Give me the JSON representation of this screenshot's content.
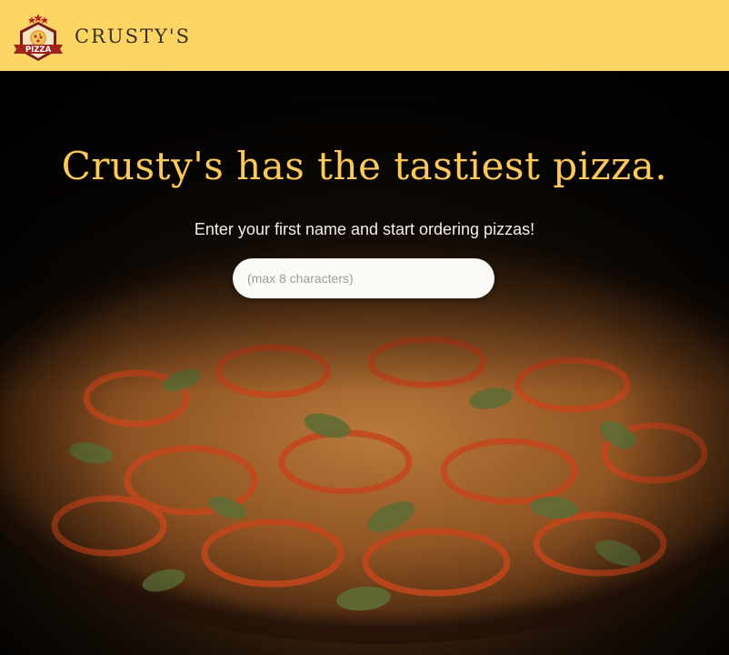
{
  "header": {
    "logo_badge_text": "PIZZA",
    "brand_name": "CRUSTY'S"
  },
  "hero": {
    "headline": "Crusty's has the tastiest pizza.",
    "subtext": "Enter your first name and start ordering pizzas!",
    "name_input": {
      "value": "",
      "placeholder": "(max 8 characters)"
    }
  },
  "colors": {
    "header_bg": "#fdd565",
    "headline": "#fdc95a",
    "brand_text": "#3a2f24"
  }
}
